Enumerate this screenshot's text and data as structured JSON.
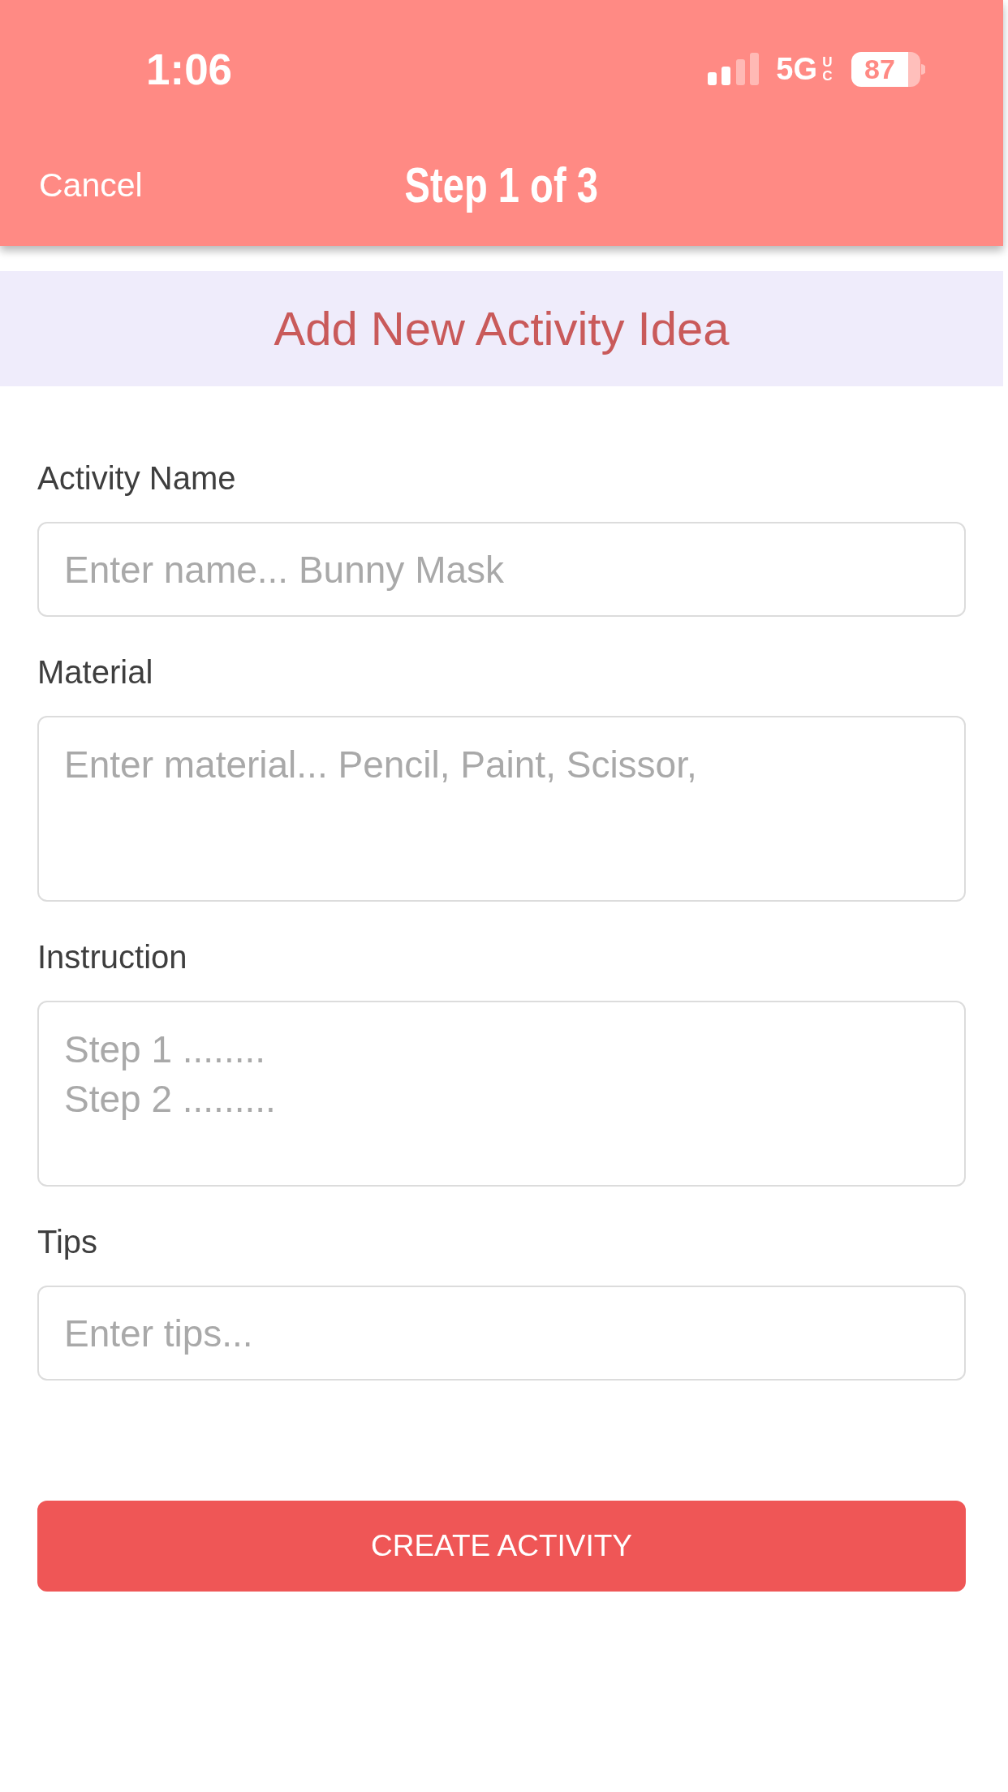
{
  "status_bar": {
    "time": "1:06",
    "network": "5G",
    "network_badge": "UC",
    "battery": "87"
  },
  "nav_bar": {
    "cancel": "Cancel",
    "title": "Step 1 of 3"
  },
  "banner": {
    "title": "Add New Activity Idea"
  },
  "fields": [
    {
      "label": "Activity Name",
      "kind": "input",
      "placeholder": "Enter name... Bunny Mask"
    },
    {
      "label": "Material",
      "kind": "textarea",
      "placeholder": "Enter material... Pencil, Paint, Scissor,"
    },
    {
      "label": "Instruction",
      "kind": "textarea",
      "placeholder": "Step 1 ........\nStep 2 ........."
    },
    {
      "label": "Tips",
      "kind": "input",
      "placeholder": "Enter tips..."
    }
  ],
  "submit_button": {
    "label": "CREATE ACTIVITY"
  }
}
